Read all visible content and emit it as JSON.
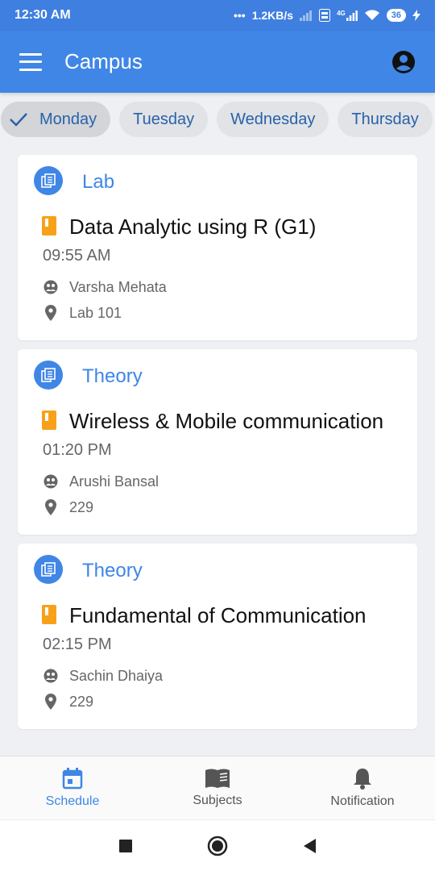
{
  "status_bar": {
    "time": "12:30 AM",
    "net_speed": "1.2KB/s",
    "network_type": "4G",
    "battery": "36"
  },
  "app_bar": {
    "title": "Campus",
    "color": "#3f86e6"
  },
  "days": [
    {
      "label": "Monday",
      "selected": true
    },
    {
      "label": "Tuesday",
      "selected": false
    },
    {
      "label": "Wednesday",
      "selected": false
    },
    {
      "label": "Thursday",
      "selected": false
    }
  ],
  "classes": [
    {
      "type": "Lab",
      "subject": "Data Analytic using R (G1)",
      "time": "09:55 AM",
      "teacher": "Varsha Mehata",
      "room": "Lab 101"
    },
    {
      "type": "Theory",
      "subject": "Wireless & Mobile communication",
      "time": "01:20 PM",
      "teacher": "Arushi Bansal",
      "room": "229"
    },
    {
      "type": "Theory",
      "subject": "Fundamental of Communication",
      "time": "02:15 PM",
      "teacher": "Sachin Dhaiya",
      "room": "229"
    }
  ],
  "bottom_nav": [
    {
      "label": "Schedule",
      "icon": "calendar-icon",
      "active": true
    },
    {
      "label": "Subjects",
      "icon": "book-icon",
      "active": false
    },
    {
      "label": "Notification",
      "icon": "bell-icon",
      "active": false
    }
  ],
  "colors": {
    "accent": "#3f86e6",
    "subject_marker": "#f7a11a",
    "chip_text": "#2962a8"
  }
}
